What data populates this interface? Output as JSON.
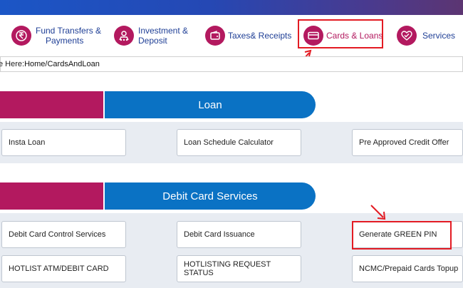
{
  "nav": {
    "items": [
      {
        "label_line1": "Fund Transfers &",
        "label_line2": "Payments",
        "icon": "rupee-icon"
      },
      {
        "label_line1": "Investment &",
        "label_line2": "Deposit",
        "icon": "investment-icon"
      },
      {
        "label_line1": "Taxes& Receipts",
        "label_line2": "",
        "icon": "wallet-icon"
      },
      {
        "label_line1": "Cards & Loans",
        "label_line2": "",
        "icon": "card-icon"
      },
      {
        "label_line1": "Services",
        "label_line2": "",
        "icon": "services-icon"
      }
    ]
  },
  "breadcrumb": {
    "prefix": "e Here: ",
    "path": "Home/CardsAndLoan"
  },
  "sections": {
    "loan": {
      "title": "Loan",
      "buttons": [
        "Insta Loan",
        "Loan Schedule Calculator",
        "Pre Approved Credit Offer"
      ]
    },
    "debit": {
      "title": "Debit Card Services",
      "buttons": [
        "Debit Card Control Services",
        "Debit Card Issuance",
        "Generate GREEN PIN",
        "HOTLIST ATM/DEBIT CARD",
        "HOTLISTING REQUEST STATUS",
        "NCMC/Prepaid Cards Topup"
      ]
    }
  },
  "colors": {
    "accent_pink": "#b3195f",
    "accent_blue": "#0a72c4",
    "nav_text": "#1f3f96",
    "highlight_red": "#e31b23"
  }
}
